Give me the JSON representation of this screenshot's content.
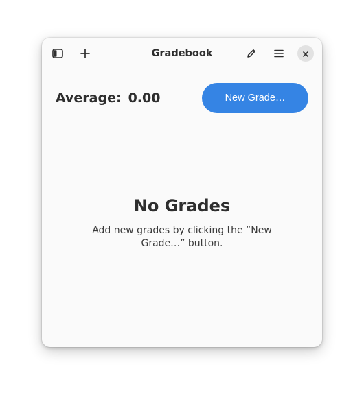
{
  "window": {
    "title": "Gradebook"
  },
  "headerbar": {
    "left_icons": [
      "sidebar-icon",
      "plus-icon"
    ],
    "right_icons": [
      "pencil-icon",
      "hamburger-menu-icon",
      "close-icon"
    ]
  },
  "summary": {
    "average_label": "Average:",
    "average_value": "0.00",
    "new_grade_button": "New Grade…"
  },
  "empty_state": {
    "title": "No Grades",
    "description": "Add new grades by clicking the “New Grade…” button."
  },
  "colors": {
    "accent": "#3584e4",
    "window_bg": "#fafafa",
    "text": "#2e2e2e"
  }
}
